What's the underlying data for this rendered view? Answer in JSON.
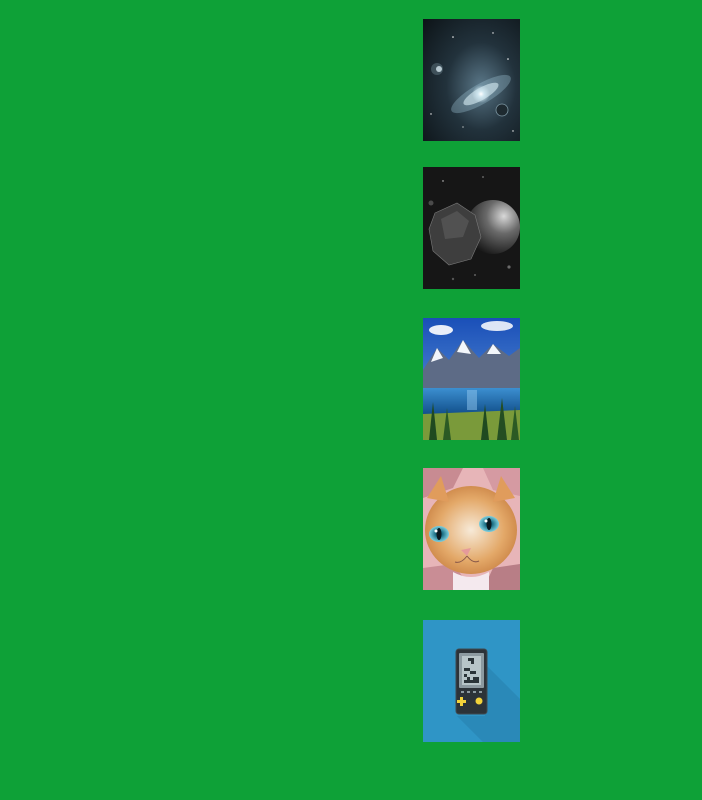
{
  "background_color": "#0ea137",
  "thumbnails": [
    {
      "icon": "galaxy-wallpaper-icon",
      "color": "#203040"
    },
    {
      "icon": "planet-asteroid-wallpaper-icon",
      "color": "#1a1a1a"
    },
    {
      "icon": "mountain-lake-wallpaper-icon",
      "color": "#2b6cb8"
    },
    {
      "icon": "cat-face-wallpaper-icon",
      "color": "#d89a60"
    },
    {
      "icon": "handheld-game-app-icon",
      "color": "#2f95c6"
    }
  ]
}
